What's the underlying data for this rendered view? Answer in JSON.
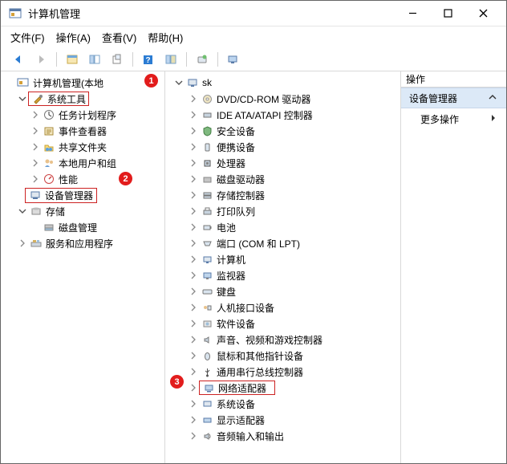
{
  "window": {
    "title": "计算机管理"
  },
  "menu": {
    "file": "文件(F)",
    "action": "操作(A)",
    "view": "查看(V)",
    "help": "帮助(H)"
  },
  "left": {
    "root": "计算机管理(本地",
    "sys_tools": "系统工具",
    "task_sched": "任务计划程序",
    "event_viewer": "事件查看器",
    "shared": "共享文件夹",
    "users": "本地用户和组",
    "perf": "性能",
    "devmgr": "设备管理器",
    "storage": "存储",
    "diskmgmt": "磁盘管理",
    "services": "服务和应用程序"
  },
  "mid": {
    "root": "sk",
    "dvd": "DVD/CD-ROM 驱动器",
    "ide": "IDE ATA/ATAPI 控制器",
    "security": "安全设备",
    "portable": "便携设备",
    "cpu": "处理器",
    "diskdrv": "磁盘驱动器",
    "storage_ctrl": "存储控制器",
    "printq": "打印队列",
    "battery": "电池",
    "ports": "端口 (COM 和 LPT)",
    "computer": "计算机",
    "monitor": "监视器",
    "keyboard": "键盘",
    "hid": "人机接口设备",
    "software_dev": "软件设备",
    "sound": "声音、视频和游戏控制器",
    "mouse": "鼠标和其他指针设备",
    "usb": "通用串行总线控制器",
    "net": "网络适配器",
    "sysdev": "系统设备",
    "display": "显示适配器",
    "audio_io": "音频输入和输出"
  },
  "right": {
    "header": "操作",
    "title": "设备管理器",
    "more": "更多操作"
  },
  "badges": {
    "one": "1",
    "two": "2",
    "three": "3"
  }
}
